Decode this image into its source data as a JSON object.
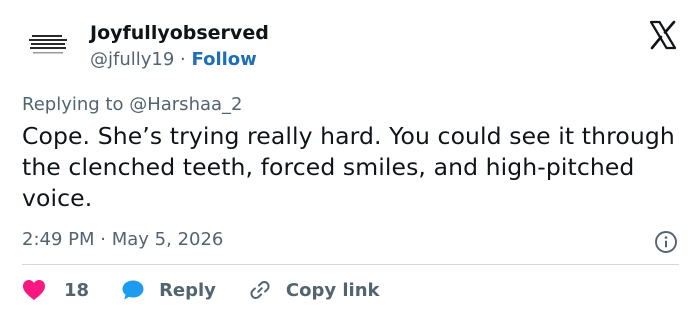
{
  "author": {
    "name": "Joyfullyobserved",
    "handle": "@jfully19",
    "separator": "·",
    "follow_label": "Follow",
    "avatar_icon": "quote-card-avatar"
  },
  "replying_prefix": "Replying to",
  "replying_to": "@Harshaa_2",
  "tweet_text": "Cope. She’s trying really hard. You could see it through the clenched teeth, forced smiles, and high-pitched voice.",
  "meta": {
    "time": "2:49 PM",
    "separator": "·",
    "date": "May 5, 2026"
  },
  "actions": {
    "like_count": "18",
    "reply_label": "Reply",
    "copy_label": "Copy link"
  },
  "icons": {
    "brand": "x-logo-icon",
    "info": "info-icon",
    "like": "heart-icon",
    "reply": "speech-bubble-icon",
    "copy": "link-icon"
  },
  "colors": {
    "text": "#0f1419",
    "secondary": "#536471",
    "follow": "#1d6fb8",
    "heart": "#f91880",
    "reply_bubble": "#1d9bf0",
    "divider": "#cfd9de"
  }
}
